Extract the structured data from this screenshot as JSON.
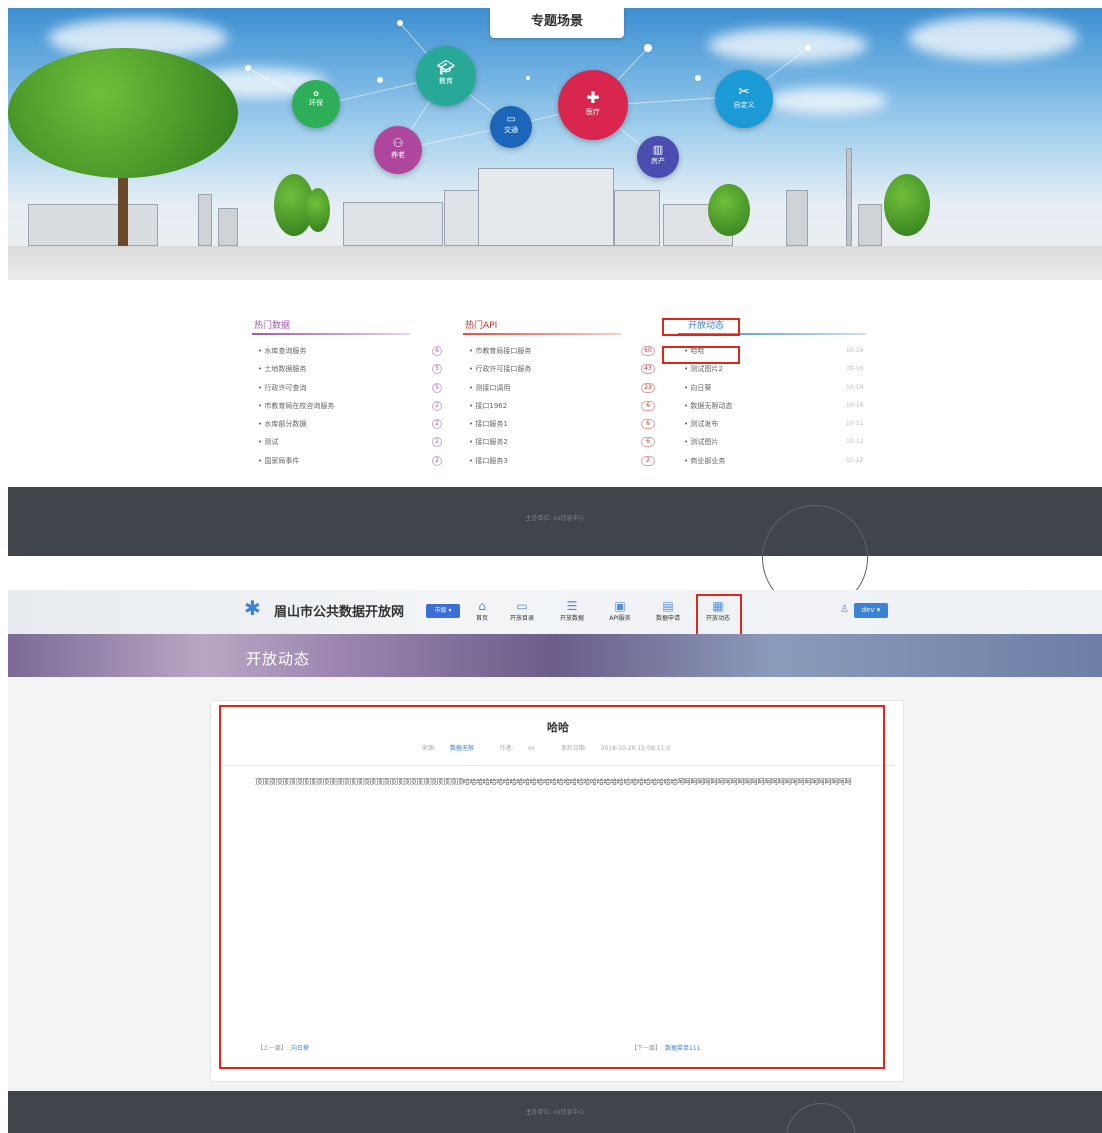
{
  "top_screenshot": {
    "hero": {
      "title": "专题场景",
      "bubbles": [
        {
          "label": "环保",
          "icon": "leaf-globe-icon",
          "color": "#2fae5a"
        },
        {
          "label": "教育",
          "icon": "graduation-cap-icon",
          "color": "#28a896"
        },
        {
          "label": "养老",
          "icon": "elderly-people-icon",
          "color": "#b0479e"
        },
        {
          "label": "交通",
          "icon": "bus-icon",
          "color": "#1b66b8"
        },
        {
          "label": "医疗",
          "icon": "medical-kit-icon",
          "color": "#d9264e"
        },
        {
          "label": "房产",
          "icon": "building-icon",
          "color": "#4b4db0"
        },
        {
          "label": "自定义",
          "icon": "tools-icon",
          "color": "#1c9ad6"
        }
      ]
    },
    "hot_data": {
      "title": "热门数据",
      "items": [
        {
          "label": "水库查询服务",
          "count": "6"
        },
        {
          "label": "土地数据服务",
          "count": "5"
        },
        {
          "label": "行政许可查询",
          "count": "5"
        },
        {
          "label": "市教育局在校咨询服务",
          "count": "2"
        },
        {
          "label": "水库部分数据",
          "count": "2"
        },
        {
          "label": "测试",
          "count": "2"
        },
        {
          "label": "国家局事件",
          "count": "2"
        }
      ]
    },
    "hot_api": {
      "title": "热门API",
      "items": [
        {
          "label": "市教育局接口服务",
          "count": "60"
        },
        {
          "label": "行政许可接口服务",
          "count": "43"
        },
        {
          "label": "测接口调用",
          "count": "23"
        },
        {
          "label": "接口1962",
          "count": "6"
        },
        {
          "label": "接口服务1",
          "count": "6"
        },
        {
          "label": "接口服务2",
          "count": "6"
        },
        {
          "label": "接口服务3",
          "count": "2"
        }
      ]
    },
    "open_news": {
      "title": "开放动态",
      "items": [
        {
          "label": "哈哈",
          "date": "10-16"
        },
        {
          "label": "测试图片2",
          "date": "10-16"
        },
        {
          "label": "向日葵",
          "date": "10-16"
        },
        {
          "label": "数据无限动态",
          "date": "10-16"
        },
        {
          "label": "测试发布",
          "date": "10-12"
        },
        {
          "label": "测试图片",
          "date": "10-12"
        },
        {
          "label": "商业部业务",
          "date": "10-12"
        }
      ]
    },
    "footer": {
      "text": "主办单位: xx信息中心"
    }
  },
  "bottom_screenshot": {
    "header": {
      "site_name": "眉山市公共数据开放网",
      "city_selector": "市级 ▾",
      "nav": [
        {
          "label": "首页",
          "icon": "home-icon"
        },
        {
          "label": "开放目录",
          "icon": "folder-icon"
        },
        {
          "label": "开放数据",
          "icon": "database-icon"
        },
        {
          "label": "API服务",
          "icon": "api-icon"
        },
        {
          "label": "数据申请",
          "icon": "apply-icon"
        },
        {
          "label": "开放动态",
          "icon": "news-icon"
        }
      ],
      "user": "dev ▾"
    },
    "banner": {
      "title": "开放动态"
    },
    "article": {
      "title": "哈哈",
      "meta": {
        "source_label": "来源:",
        "source_value": "数据无限",
        "author_label": "作者:",
        "author_value": "vv",
        "date_label": "发布日期:",
        "date_value": "2018-10-16 15:08:11.0"
      },
      "content": "顶顶顶顶顶顶顶顶顶顶顶顶顶顶顶顶顶顶顶顶顶顶顶顶顶顶顶顶顶顶顶哈哈哈哈哈哈哈哈哈哈哈哈哈哈哈哈哈哈哈哈哈哈哈哈哈哈哈哈哈哈哈哈呵呵呵呵呵呵呵呵呵呵呵呵呵呵呵呵呵呵呵呵呵呵呵呵呵呵",
      "prev_label": "【上一篇】:",
      "prev_link": "向日葵",
      "next_label": "【下一篇】:",
      "next_link": "数据菜单111"
    },
    "footer": {
      "text": "主办单位: xx信息中心"
    }
  }
}
